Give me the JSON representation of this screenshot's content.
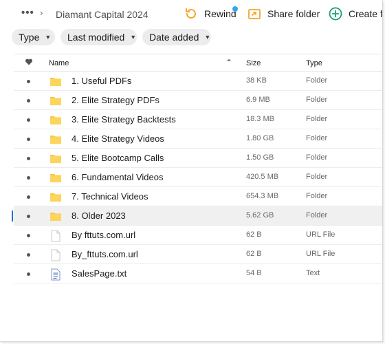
{
  "header": {
    "more_label": "•••",
    "breadcrumb": "Diamant Capital 2024",
    "actions": {
      "rewind": "Rewind",
      "share": "Share folder",
      "create": "Create fo"
    },
    "accent": "#37a6f0"
  },
  "filters": {
    "type": "Type",
    "last_modified": "Last modified",
    "date_added": "Date added"
  },
  "table": {
    "headers": {
      "name": "Name",
      "size": "Size",
      "type": "Type"
    },
    "rows": [
      {
        "name": "1. Useful PDFs",
        "size": "38 KB",
        "type": "Folder",
        "icon": "folder-icon"
      },
      {
        "name": "2. Elite Strategy PDFs",
        "size": "6.9 MB",
        "type": "Folder",
        "icon": "folder-icon"
      },
      {
        "name": "3. Elite Strategy Backtests",
        "size": "18.3 MB",
        "type": "Folder",
        "icon": "folder-icon"
      },
      {
        "name": "4. Elite Strategy Videos",
        "size": "1.80 GB",
        "type": "Folder",
        "icon": "folder-icon"
      },
      {
        "name": "5. Elite Bootcamp Calls",
        "size": "1.50 GB",
        "type": "Folder",
        "icon": "folder-icon"
      },
      {
        "name": "6. Fundamental Videos",
        "size": "420.5 MB",
        "type": "Folder",
        "icon": "folder-icon"
      },
      {
        "name": "7. Technical Videos",
        "size": "654.3 MB",
        "type": "Folder",
        "icon": "folder-icon"
      },
      {
        "name": "8. Older 2023",
        "size": "5.62 GB",
        "type": "Folder",
        "icon": "folder-icon",
        "selected": true
      },
      {
        "name": "By fttuts.com.url",
        "size": "62 B",
        "type": "URL File",
        "icon": "file-icon"
      },
      {
        "name": "By_fttuts.com.url",
        "size": "62 B",
        "type": "URL File",
        "icon": "file-icon"
      },
      {
        "name": "SalesPage.txt",
        "size": "54 B",
        "type": "Text",
        "icon": "text-file-icon"
      }
    ]
  }
}
